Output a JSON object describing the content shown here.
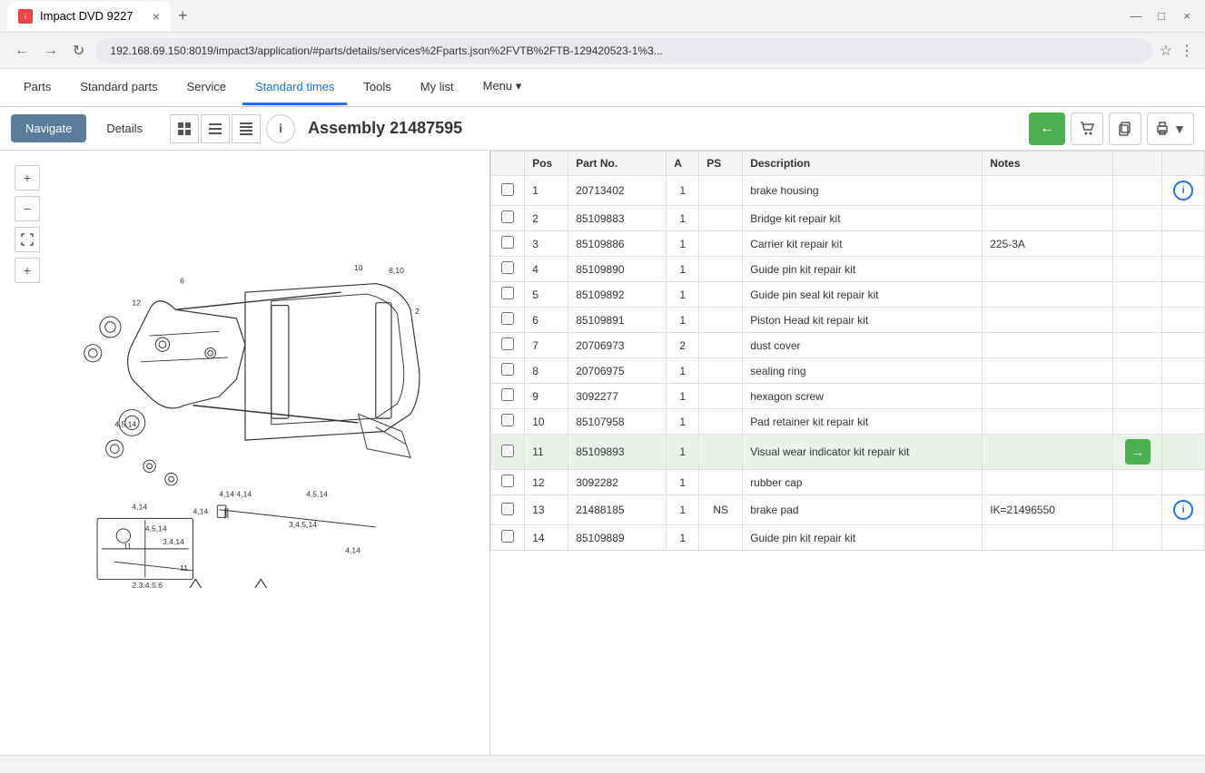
{
  "browser": {
    "tab_title": "Impact DVD  9227",
    "tab_close": "×",
    "tab_add": "+",
    "address": "192.168.69.150:8019/impact3/application/#parts/details/services%2Fparts.json%2FVTB%2FTB-129420523-1%3...",
    "window_controls": [
      "—",
      "□",
      "×"
    ]
  },
  "nav": {
    "items": [
      {
        "label": "Parts",
        "active": false
      },
      {
        "label": "Standard parts",
        "active": false
      },
      {
        "label": "Service",
        "active": false
      },
      {
        "label": "Standard times",
        "active": true
      },
      {
        "label": "Tools",
        "active": false
      },
      {
        "label": "My list",
        "active": false
      },
      {
        "label": "Menu ▾",
        "active": false
      }
    ]
  },
  "toolbar": {
    "navigate_label": "Navigate",
    "details_label": "Details",
    "assembly_title": "Assembly 21487595",
    "back_arrow": "←",
    "cart_icon": "🛒",
    "copy_icon": "⧉",
    "print_icon": "🖨",
    "print_arrow": "▾"
  },
  "diagram": {
    "zoom_in": "+",
    "zoom_out": "−",
    "fit": "⤢",
    "add": "+",
    "image_label": "Brake Assembly Diagram"
  },
  "table": {
    "headers": [
      "",
      "Pos",
      "Part No.",
      "A",
      "PS",
      "Description",
      "Notes",
      "",
      ""
    ],
    "rows": [
      {
        "pos": "1",
        "partno": "20713402",
        "a": "1",
        "ps": "",
        "desc": "brake housing",
        "notes": "",
        "has_info": true,
        "has_arrow": false,
        "selected": false
      },
      {
        "pos": "2",
        "partno": "85109883",
        "a": "1",
        "ps": "",
        "desc": "Bridge kit repair kit",
        "notes": "",
        "has_info": false,
        "has_arrow": false,
        "selected": false
      },
      {
        "pos": "3",
        "partno": "85109886",
        "a": "1",
        "ps": "",
        "desc": "Carrier kit repair kit",
        "notes": "225-3A",
        "has_info": false,
        "has_arrow": false,
        "selected": false
      },
      {
        "pos": "4",
        "partno": "85109890",
        "a": "1",
        "ps": "",
        "desc": "Guide pin kit repair kit",
        "notes": "",
        "has_info": false,
        "has_arrow": false,
        "selected": false
      },
      {
        "pos": "5",
        "partno": "85109892",
        "a": "1",
        "ps": "",
        "desc": "Guide pin seal kit repair kit",
        "notes": "",
        "has_info": false,
        "has_arrow": false,
        "selected": false
      },
      {
        "pos": "6",
        "partno": "85109891",
        "a": "1",
        "ps": "",
        "desc": "Piston Head kit repair kit",
        "notes": "",
        "has_info": false,
        "has_arrow": false,
        "selected": false
      },
      {
        "pos": "7",
        "partno": "20706973",
        "a": "2",
        "ps": "",
        "desc": "dust cover",
        "notes": "",
        "has_info": false,
        "has_arrow": false,
        "selected": false
      },
      {
        "pos": "8",
        "partno": "20706975",
        "a": "1",
        "ps": "",
        "desc": "sealing ring",
        "notes": "",
        "has_info": false,
        "has_arrow": false,
        "selected": false
      },
      {
        "pos": "9",
        "partno": "3092277",
        "a": "1",
        "ps": "",
        "desc": "hexagon screw",
        "notes": "",
        "has_info": false,
        "has_arrow": false,
        "selected": false
      },
      {
        "pos": "10",
        "partno": "85107958",
        "a": "1",
        "ps": "",
        "desc": "Pad retainer kit repair kit",
        "notes": "",
        "has_info": false,
        "has_arrow": false,
        "selected": false
      },
      {
        "pos": "11",
        "partno": "85109893",
        "a": "1",
        "ps": "",
        "desc": "Visual wear indicator kit repair kit",
        "notes": "",
        "has_info": false,
        "has_arrow": true,
        "selected": true
      },
      {
        "pos": "12",
        "partno": "3092282",
        "a": "1",
        "ps": "",
        "desc": "rubber cap",
        "notes": "",
        "has_info": false,
        "has_arrow": false,
        "selected": false
      },
      {
        "pos": "13",
        "partno": "21488185",
        "a": "1",
        "ps": "NS",
        "desc": "brake pad",
        "notes": "IK=21496550",
        "has_info": true,
        "has_arrow": false,
        "selected": false
      },
      {
        "pos": "14",
        "partno": "85109889",
        "a": "1",
        "ps": "",
        "desc": "Guide pin kit repair kit",
        "notes": "",
        "has_info": false,
        "has_arrow": false,
        "selected": false
      }
    ]
  },
  "colors": {
    "green": "#4caf50",
    "blue": "#1a73e8",
    "nav_active": "#1a73e8",
    "tab_active": "#5c7c9b",
    "header_bg": "#f5f5f5",
    "selected_row": "#e8f4e8"
  }
}
